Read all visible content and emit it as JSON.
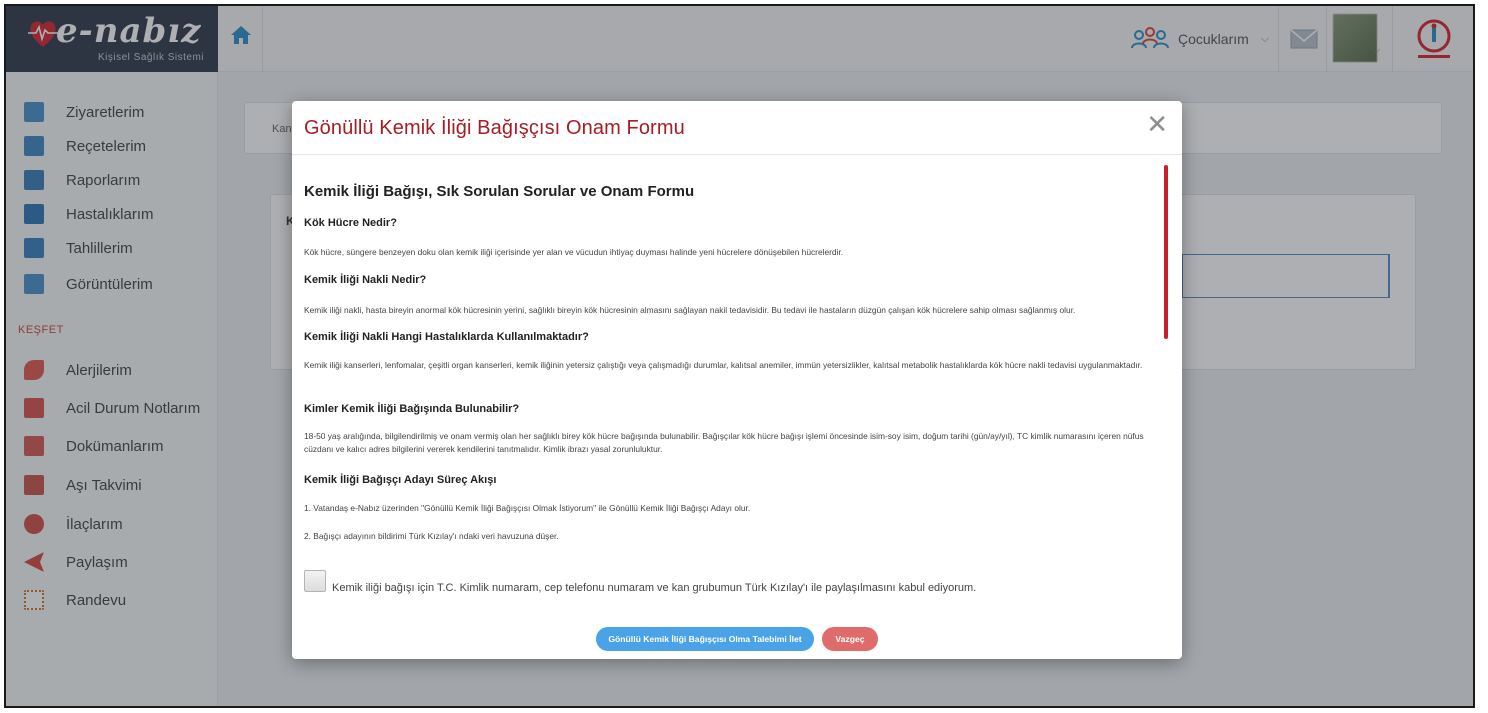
{
  "app": {
    "logo_title": "e-nabız",
    "logo_subtitle": "Kişisel Sağlık Sistemi"
  },
  "header": {
    "children_label": "Çocuklarım"
  },
  "sidebar": {
    "items": [
      {
        "label": "Ziyaretlerim",
        "icon": "hospital-icon",
        "color": "#4a90c8"
      },
      {
        "label": "Reçetelerim",
        "icon": "prescription-icon",
        "color": "#3f87c4"
      },
      {
        "label": "Raporlarım",
        "icon": "report-icon",
        "color": "#3b7fb9"
      },
      {
        "label": "Hastalıklarım",
        "icon": "disease-icon",
        "color": "#2f76b5"
      },
      {
        "label": "Tahlillerim",
        "icon": "test-tubes-icon",
        "color": "#3a80bf"
      },
      {
        "label": "Görüntülerim",
        "icon": "imaging-icon",
        "color": "#4a90c8"
      }
    ],
    "section_label": "KEŞFET",
    "discover_items": [
      {
        "label": "Alerjilerim",
        "icon": "allergy-icon",
        "color": "#e05a4f"
      },
      {
        "label": "Acil Durum Notlarım",
        "icon": "emergency-notes-icon",
        "color": "#d9534f"
      },
      {
        "label": "Dokümanlarım",
        "icon": "documents-icon",
        "color": "#d55a55"
      },
      {
        "label": "Aşı Takvimi",
        "icon": "vaccine-icon",
        "color": "#c9544d"
      },
      {
        "label": "İlaçlarım",
        "icon": "medicine-icon",
        "color": "#d14f48"
      },
      {
        "label": "Paylaşım",
        "icon": "share-icon",
        "color": "#d94a44"
      },
      {
        "label": "Randevu",
        "icon": "calendar-icon",
        "color": "#c8742c"
      }
    ]
  },
  "background": {
    "card1_text": "Kan",
    "card2_text": "K"
  },
  "modal": {
    "title": "Gönüllü Kemik İliği Bağışçısı Onam Formu",
    "doc_title": "Kemik İliği Bağışı, Sık Sorulan Sorular ve Onam Formu",
    "sections": [
      {
        "q": "Kök Hücre Nedir?",
        "a": "Kök hücre, süngere benzeyen doku olan kemik iliği içerisinde yer alan ve vücudun ihtiyaç duyması halinde yeni hücrelere dönüşebilen hücrelerdir."
      },
      {
        "q": "Kemik İliği Nakli Nedir?",
        "a": "Kemik iliği nakli, hasta bireyin anormal kök hücresinin yerini, sağlıklı bireyin kök hücresinin almasını sağlayan nakil tedavisidir. Bu tedavi ile hastaların düzgün çalışan kök hücrelere sahip olması sağlanmış olur."
      },
      {
        "q": "Kemik İliği Nakli Hangi Hastalıklarda Kullanılmaktadır?",
        "a": "Kemik iliği kanserleri, lenfomalar, çeşitli organ kanserleri, kemik iliğinin yetersiz çalıştığı veya çalışmadığı durumlar, kalıtsal anemiler, immün yetersizlikler, kalıtsal metabolik hastalıklarda kök hücre nakli tedavisi uygulanmaktadır."
      },
      {
        "q": "Kimler Kemik İliği Bağışında Bulunabilir?",
        "a": "18-50 yaş aralığında, bilgilendirilmiş ve onam vermiş olan her sağlıklı birey kök hücre bağışında bulunabilir. Bağışçılar kök hücre bağışı işlemi öncesinde isim-soy isim, doğum tarihi (gün/ay/yıl), TC kimlik numarasını içeren nüfus cüzdanı ve kalıcı adres bilgilerini vererek kendilerini tanıtmalıdır. Kimlik ibrazı yasal zorunluluktur."
      },
      {
        "q": "Kemik İliği Bağışçı Adayı Süreç Akışı",
        "a": "1. Vatandaş e-Nabız üzerinden \"Gönüllü Kemik İliği Bağışçısı Olmak İstiyorum\" ile Gönüllü Kemik İliği Bağışçı Adayı olur."
      }
    ],
    "step2": "2. Bağışçı adayının bildirimi Türk Kızılay'ı ndaki veri havuzuna düşer.",
    "consent_text": "Kemik iliği bağışı için T.C. Kimlik numaram, cep telefonu numaram ve kan grubumun Türk Kızılay'ı ile paylaşılmasını kabul ediyorum.",
    "submit_label": "Gönüllü Kemik İliği Bağışçısı Olma Talebimi İlet",
    "cancel_label": "Vazgeç"
  },
  "colors": {
    "accent_red": "#a61d24",
    "primary_blue": "#4aa3e6",
    "cancel_red": "#e06b6b"
  }
}
